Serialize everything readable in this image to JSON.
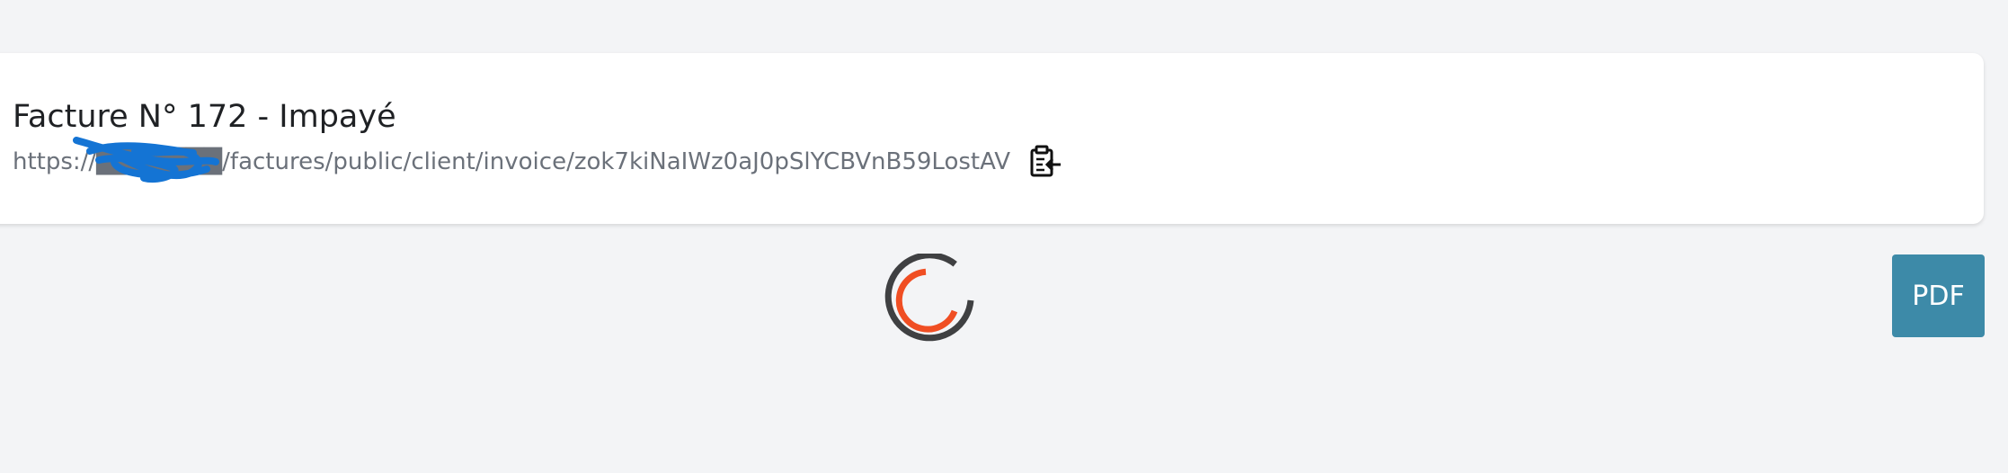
{
  "invoice": {
    "title": "Facture N° 172 - Impayé",
    "public_url": "https://███████/factures/public/client/invoice/zok7kiNaIWz0aJ0pSlYCBVnB59LostAV"
  },
  "actions": {
    "copy_icon": "clipboard-paste-icon",
    "pdf_label": "PDF"
  },
  "loading": {
    "spinner_icon": "loading-spinner-icon"
  },
  "colors": {
    "background": "#f3f4f6",
    "pdf_button": "#3d8aa8",
    "spinner_outer": "#3f4042",
    "spinner_inner": "#f04e23",
    "redaction_scribble": "#1474d4"
  }
}
